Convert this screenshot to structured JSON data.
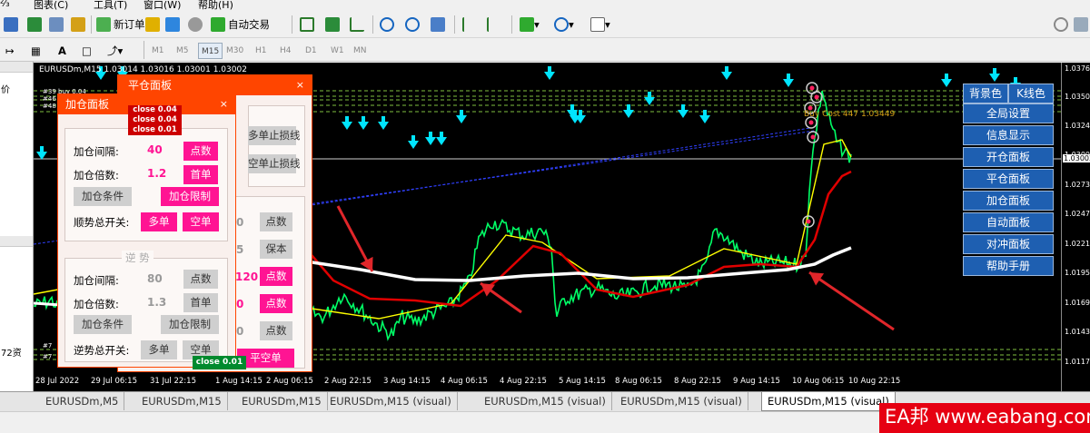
{
  "menu": {
    "items": [
      "⅔",
      "图表(C)",
      "工具(T)",
      "窗口(W)",
      "帮助(H)"
    ]
  },
  "toolbar": {
    "new_order": "新订单",
    "auto_trade": "自动交易",
    "timeframes": [
      "M1",
      "M5",
      "M15",
      "M30",
      "H1",
      "H4",
      "D1",
      "W1",
      "MN"
    ],
    "active_timeframe": "M15"
  },
  "chart": {
    "info": "EURUSDm,M15  1.03014 1.03016 1.03001 1.03002",
    "annotation": "Buy Cost 447 1.03449",
    "prices": [
      "1.03760",
      "1.03500",
      "1.03240",
      "1.03000",
      "1.02730",
      "1.02470",
      "1.02210",
      "1.01950",
      "1.01690",
      "1.01430",
      "1.01170"
    ],
    "current_price": "1.03002",
    "times": [
      "28 Jul 2022",
      "29 Jul 06:15",
      "31 Jul 22:15",
      "1 Aug 14:15",
      "2 Aug 06:15",
      "2 Aug 22:15",
      "3 Aug 14:15",
      "4 Aug 06:15",
      "4 Aug 22:15",
      "5 Aug 14:15",
      "8 Aug 06:15",
      "8 Aug 22:15",
      "9 Aug 14:15",
      "10 Aug 06:15",
      "10 Aug 22:15"
    ],
    "order_labels": [
      "#39 buy 0.04",
      "#46",
      "#48",
      "#7",
      "#7"
    ]
  },
  "close_panel": {
    "title": "平仓面板",
    "close_x": "×",
    "badges": [
      "close 0.04",
      "close 0.04",
      "close 0.01"
    ],
    "green_badge": "close 0.01",
    "right_buttons": [
      "多单止损线",
      "空单止损线"
    ],
    "right_rows": [
      {
        "val": "0",
        "btn": "点数"
      },
      {
        "val": "5",
        "btn": "保本"
      },
      {
        "val": "120",
        "btn": "点数"
      },
      {
        "val": "0",
        "btn": "点数"
      },
      {
        "val": "0",
        "btn": "点数"
      }
    ],
    "bottom_button": "平空单"
  },
  "add_panel": {
    "title": "加仓面板",
    "close_x": "×",
    "follow": {
      "interval_label": "加仓间隔:",
      "interval_value": "40",
      "interval_btn": "点数",
      "multiple_label": "加仓倍数:",
      "multiple_value": "1.2",
      "multiple_btn": "首单",
      "condition_btn": "加仓条件",
      "limit_btn": "加仓限制",
      "switch_label": "顺势总开关:",
      "buy_btn": "多单",
      "sell_btn": "空单"
    },
    "counter": {
      "group_label": "逆  势",
      "interval_label": "加仓间隔:",
      "interval_value": "80",
      "interval_btn": "点数",
      "multiple_label": "加仓倍数:",
      "multiple_value": "1.3",
      "multiple_btn": "首单",
      "condition_btn": "加仓条件",
      "limit_btn": "加仓限制",
      "switch_label": "逆势总开关:",
      "buy_btn": "多单",
      "sell_btn": "空单"
    }
  },
  "right_menu": {
    "bg_btn": "背景色",
    "kline_btn": "K线色",
    "items": [
      "全局设置",
      "信息显示",
      "开仓面板",
      "平仓面板",
      "加仓面板",
      "自动面板",
      "对冲面板",
      "帮助手册"
    ]
  },
  "tabs": [
    "EURUSDm,M5",
    "EURUSDm,M15",
    "EURUSDm,M15",
    "EURUSDm,M15 (visual)",
    "EURUSDm,M15 (visual)",
    "EURUSDm,M15 (visual)",
    "EURUSDm,M15 (visual)"
  ],
  "active_tab": 6,
  "watermark": "EA邦 www.eabang.com",
  "left_labels": [
    "价",
    "72资"
  ],
  "colors": {
    "panel_header": "#ff4500",
    "button": "#ff1493",
    "menu_button": "#1e5fb1",
    "up_arrow": "#00e5ff",
    "candles": "#00ff66",
    "ma_fast": "#ffff00",
    "ma_mid": "#e00000",
    "ma_slow": "#ffffff",
    "annotation_arrow": "#e0262a"
  }
}
